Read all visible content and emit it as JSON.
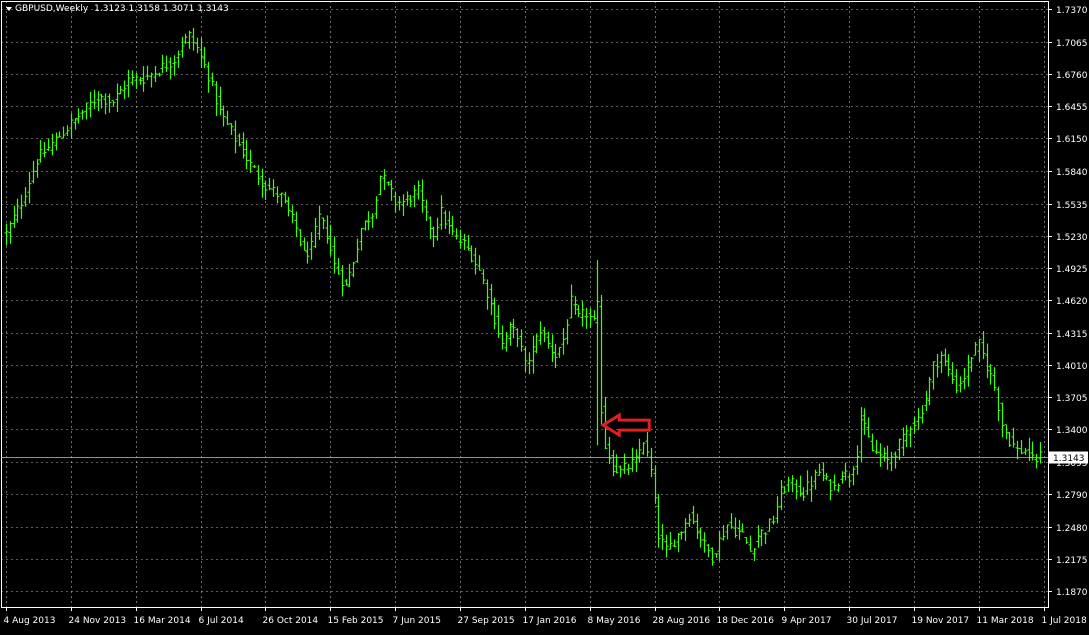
{
  "header": {
    "symbol_label": "GBPUSD,Weekly",
    "ohlc_label": "1.3123 1.3158 1.3071 1.3143",
    "collapse_icon": "triangle-down-icon"
  },
  "current_price": "1.3143",
  "colors": {
    "background": "#000000",
    "grid": "#ffffff",
    "bars": "#3cff00",
    "price_line": "#c0c0c0",
    "arrow": "#e02020"
  },
  "annotation": {
    "type": "arrow-left",
    "color": "#e02020",
    "points_to_date": "24 Jun 2016"
  },
  "chart_data": {
    "type": "ohlc",
    "title": "",
    "xlabel": "",
    "ylabel": "",
    "ylim": [
      1.172,
      1.745
    ],
    "grid": true,
    "y_ticks": [
      "1.7370",
      "1.7065",
      "1.6760",
      "1.6455",
      "1.6150",
      "1.5840",
      "1.5535",
      "1.5230",
      "1.4925",
      "1.4620",
      "1.4315",
      "1.4010",
      "1.3705",
      "1.3400",
      "1.3095",
      "1.2790",
      "1.2480",
      "1.2175",
      "1.1870"
    ],
    "x_ticks": [
      "4 Aug 2013",
      "24 Nov 2013",
      "16 Mar 2014",
      "6 Jul 2014",
      "26 Oct 2014",
      "15 Feb 2015",
      "7 Jun 2015",
      "27 Sep 2015",
      "17 Jan 2016",
      "8 May 2016",
      "28 Aug 2016",
      "18 Dec 2016",
      "9 Apr 2017",
      "30 Jul 2017",
      "19 Nov 2017",
      "11 Mar 2018",
      "1 Jul 2018"
    ],
    "close_path": [
      {
        "w": 0,
        "p": 1.525
      },
      {
        "w": 4,
        "p": 1.555
      },
      {
        "w": 8,
        "p": 1.595
      },
      {
        "w": 12,
        "p": 1.61
      },
      {
        "w": 16,
        "p": 1.625
      },
      {
        "w": 20,
        "p": 1.64
      },
      {
        "w": 24,
        "p": 1.655
      },
      {
        "w": 28,
        "p": 1.65
      },
      {
        "w": 32,
        "p": 1.67
      },
      {
        "w": 36,
        "p": 1.672
      },
      {
        "w": 40,
        "p": 1.68
      },
      {
        "w": 44,
        "p": 1.69
      },
      {
        "w": 46,
        "p": 1.705
      },
      {
        "w": 48,
        "p": 1.712
      },
      {
        "w": 50,
        "p": 1.7
      },
      {
        "w": 53,
        "p": 1.675
      },
      {
        "w": 56,
        "p": 1.64
      },
      {
        "w": 60,
        "p": 1.615
      },
      {
        "w": 64,
        "p": 1.59
      },
      {
        "w": 68,
        "p": 1.57
      },
      {
        "w": 72,
        "p": 1.56
      },
      {
        "w": 76,
        "p": 1.53
      },
      {
        "w": 78,
        "p": 1.505
      },
      {
        "w": 80,
        "p": 1.512
      },
      {
        "w": 82,
        "p": 1.54
      },
      {
        "w": 84,
        "p": 1.525
      },
      {
        "w": 86,
        "p": 1.495
      },
      {
        "w": 89,
        "p": 1.475
      },
      {
        "w": 91,
        "p": 1.5
      },
      {
        "w": 93,
        "p": 1.53
      },
      {
        "w": 96,
        "p": 1.545
      },
      {
        "w": 98,
        "p": 1.58
      },
      {
        "w": 100,
        "p": 1.57
      },
      {
        "w": 102,
        "p": 1.555
      },
      {
        "w": 104,
        "p": 1.555
      },
      {
        "w": 108,
        "p": 1.565
      },
      {
        "w": 110,
        "p": 1.54
      },
      {
        "w": 112,
        "p": 1.525
      },
      {
        "w": 114,
        "p": 1.545
      },
      {
        "w": 116,
        "p": 1.53
      },
      {
        "w": 118,
        "p": 1.52
      },
      {
        "w": 120,
        "p": 1.515
      },
      {
        "w": 122,
        "p": 1.505
      },
      {
        "w": 124,
        "p": 1.49
      },
      {
        "w": 126,
        "p": 1.47
      },
      {
        "w": 128,
        "p": 1.445
      },
      {
        "w": 130,
        "p": 1.42
      },
      {
        "w": 132,
        "p": 1.435
      },
      {
        "w": 134,
        "p": 1.43
      },
      {
        "w": 136,
        "p": 1.4
      },
      {
        "w": 138,
        "p": 1.415
      },
      {
        "w": 140,
        "p": 1.435
      },
      {
        "w": 142,
        "p": 1.42
      },
      {
        "w": 144,
        "p": 1.41
      },
      {
        "w": 146,
        "p": 1.425
      },
      {
        "w": 148,
        "p": 1.46
      },
      {
        "w": 150,
        "p": 1.445
      },
      {
        "w": 152,
        "p": 1.45
      },
      {
        "w": 154,
        "p": 1.44
      },
      {
        "w": 155,
        "p": 1.455
      },
      {
        "w": 156,
        "p": 1.36
      },
      {
        "w": 157,
        "p": 1.325
      },
      {
        "w": 159,
        "p": 1.305
      },
      {
        "w": 161,
        "p": 1.3
      },
      {
        "w": 163,
        "p": 1.305
      },
      {
        "w": 165,
        "p": 1.31
      },
      {
        "w": 167,
        "p": 1.33
      },
      {
        "w": 169,
        "p": 1.3
      },
      {
        "w": 171,
        "p": 1.24
      },
      {
        "w": 173,
        "p": 1.225
      },
      {
        "w": 175,
        "p": 1.235
      },
      {
        "w": 177,
        "p": 1.245
      },
      {
        "w": 179,
        "p": 1.26
      },
      {
        "w": 181,
        "p": 1.245
      },
      {
        "w": 183,
        "p": 1.23
      },
      {
        "w": 185,
        "p": 1.22
      },
      {
        "w": 187,
        "p": 1.235
      },
      {
        "w": 189,
        "p": 1.25
      },
      {
        "w": 191,
        "p": 1.245
      },
      {
        "w": 193,
        "p": 1.24
      },
      {
        "w": 195,
        "p": 1.225
      },
      {
        "w": 197,
        "p": 1.24
      },
      {
        "w": 199,
        "p": 1.245
      },
      {
        "w": 201,
        "p": 1.255
      },
      {
        "w": 203,
        "p": 1.28
      },
      {
        "w": 205,
        "p": 1.29
      },
      {
        "w": 207,
        "p": 1.285
      },
      {
        "w": 209,
        "p": 1.28
      },
      {
        "w": 211,
        "p": 1.29
      },
      {
        "w": 213,
        "p": 1.3
      },
      {
        "w": 215,
        "p": 1.29
      },
      {
        "w": 217,
        "p": 1.285
      },
      {
        "w": 219,
        "p": 1.3
      },
      {
        "w": 221,
        "p": 1.295
      },
      {
        "w": 223,
        "p": 1.32
      },
      {
        "w": 224,
        "p": 1.35
      },
      {
        "w": 225,
        "p": 1.34
      },
      {
        "w": 227,
        "p": 1.32
      },
      {
        "w": 229,
        "p": 1.315
      },
      {
        "w": 231,
        "p": 1.31
      },
      {
        "w": 233,
        "p": 1.32
      },
      {
        "w": 235,
        "p": 1.33
      },
      {
        "w": 237,
        "p": 1.345
      },
      {
        "w": 239,
        "p": 1.35
      },
      {
        "w": 241,
        "p": 1.37
      },
      {
        "w": 243,
        "p": 1.4
      },
      {
        "w": 245,
        "p": 1.41
      },
      {
        "w": 247,
        "p": 1.395
      },
      {
        "w": 249,
        "p": 1.38
      },
      {
        "w": 251,
        "p": 1.39
      },
      {
        "w": 253,
        "p": 1.41
      },
      {
        "w": 255,
        "p": 1.42
      },
      {
        "w": 257,
        "p": 1.4
      },
      {
        "w": 259,
        "p": 1.38
      },
      {
        "w": 261,
        "p": 1.345
      },
      {
        "w": 263,
        "p": 1.33
      },
      {
        "w": 265,
        "p": 1.32
      },
      {
        "w": 267,
        "p": 1.32
      },
      {
        "w": 269,
        "p": 1.31
      },
      {
        "w": 271,
        "p": 1.314
      }
    ]
  }
}
